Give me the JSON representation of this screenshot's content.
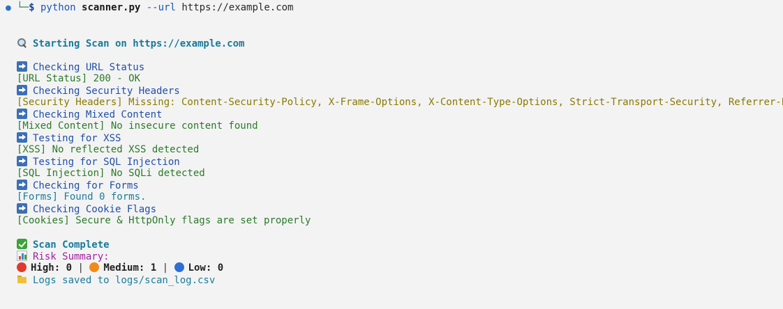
{
  "colors": {
    "background": "#f3f3f3",
    "step": "#1f4fa8",
    "ok": "#2a7a2a",
    "warn": "#8a7a00",
    "info": "#1c7c9c",
    "high": "#e03a2e",
    "medium": "#f08a1a",
    "low": "#2d6fd4"
  },
  "prompt": {
    "command": "python",
    "script": "scanner.py",
    "flag": "--url",
    "url": "https://example.com"
  },
  "header": {
    "icon": "magnifier-icon",
    "text": "Starting Scan on https://example.com"
  },
  "checks": [
    {
      "step": "Checking URL Status",
      "result": "[URL Status] 200 - OK",
      "level": "ok"
    },
    {
      "step": "Checking Security Headers",
      "result": "[Security Headers] Missing: Content-Security-Policy, X-Frame-Options, X-Content-Type-Options, Strict-Transport-Security, Referrer-Policy",
      "level": "warn"
    },
    {
      "step": "Checking Mixed Content",
      "result": "[Mixed Content] No insecure content found",
      "level": "ok"
    },
    {
      "step": "Testing for XSS",
      "result": "[XSS] No reflected XSS detected",
      "level": "ok"
    },
    {
      "step": "Testing for SQL Injection",
      "result": "[SQL Injection] No SQLi detected",
      "level": "ok"
    },
    {
      "step": "Checking for Forms",
      "result": "[Forms] Found 0 forms.",
      "level": "info"
    },
    {
      "step": "Checking Cookie Flags",
      "result": "[Cookies] Secure & HttpOnly flags are set properly",
      "level": "ok"
    }
  ],
  "summary": {
    "complete": "Scan Complete",
    "risk_title": "Risk Summary:",
    "high_label": "High:",
    "high_value": "0",
    "medium_label": "Medium:",
    "medium_value": "1",
    "low_label": "Low:",
    "low_value": "0",
    "separator": "|",
    "logs": "Logs saved to logs/scan_log.csv"
  }
}
